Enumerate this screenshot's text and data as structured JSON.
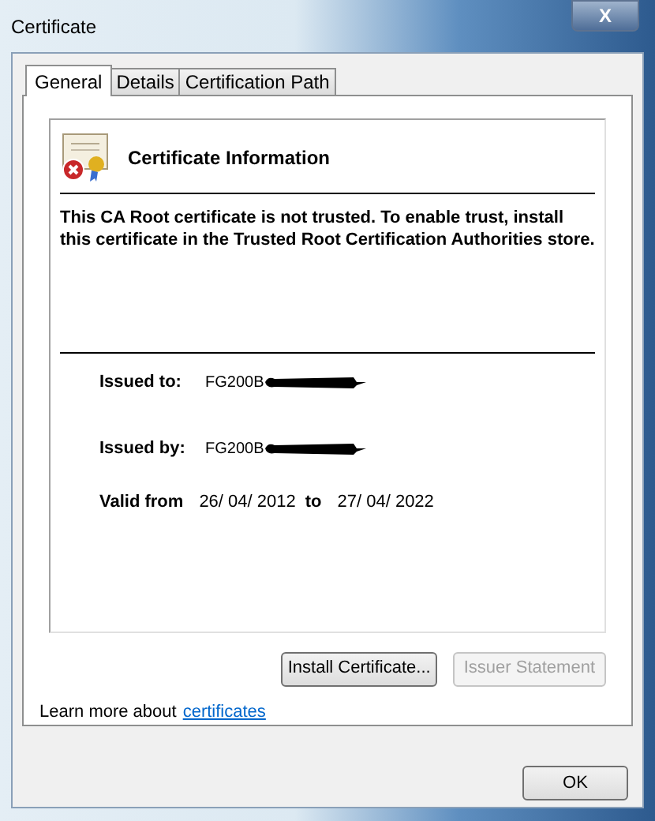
{
  "window": {
    "title": "Certificate",
    "close": "X"
  },
  "tabs": [
    {
      "label": "General",
      "selected": true
    },
    {
      "label": "Details",
      "selected": false
    },
    {
      "label": "Certification Path",
      "selected": false
    }
  ],
  "info": {
    "heading": "Certificate Information",
    "message": "This CA Root certificate is not trusted. To enable trust, install this certificate in the Trusted Root Certification Authorities store.",
    "issued_to_label": "Issued to:",
    "issued_to": "FG200B",
    "issued_by_label": "Issued by:",
    "issued_by": "FG200B",
    "valid_from_label": "Valid from",
    "valid_from": "26/ 04/ 2012",
    "valid_to_label": "to",
    "valid_to": "27/ 04/ 2022"
  },
  "buttons": [
    {
      "label": "Install Certificate...",
      "disabled": false
    },
    {
      "label": "Issuer Statement",
      "disabled": true
    }
  ],
  "learn_more": {
    "text": "Learn more about",
    "link": "certificates"
  },
  "ok_button": "OK"
}
